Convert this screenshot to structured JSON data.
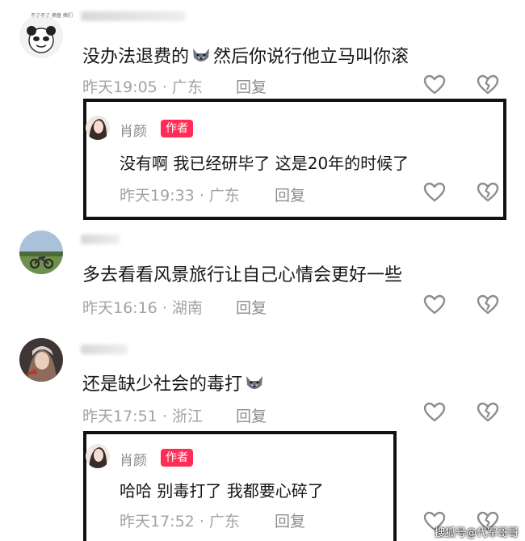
{
  "comments": [
    {
      "text": "没办法退费的",
      "text_after_emoji": "然后你说行他立马叫你滚",
      "time": "昨天19:05",
      "location": "广东",
      "reply": "回复",
      "avatar_caption_1": "不了不了",
      "avatar_caption_2": "摘盘 摘们",
      "reply_entry": {
        "author": "肖颜",
        "badge": "作者",
        "text": "没有啊 我已经研毕了 这是20年的时候了",
        "time": "昨天19:33",
        "location": "广东",
        "reply": "回复"
      }
    },
    {
      "text": "多去看看风景旅行让自己心情会更好一些",
      "time": "昨天16:16",
      "location": "湖南",
      "reply": "回复"
    },
    {
      "text": "还是缺少社会的毒打",
      "time": "昨天17:51",
      "location": "浙江",
      "reply": "回复",
      "reply_entry": {
        "author": "肖颜",
        "badge": "作者",
        "text": "哈哈 别毒打了 我都要心碎了",
        "time": "昨天17:52",
        "location": "广东",
        "reply": "回复"
      }
    }
  ],
  "separator": "·",
  "watermark": "搜狐号@代军哥哥",
  "icons": {
    "like": "heart-outline-icon",
    "dislike": "broken-heart-icon",
    "emoji": "husky-dog-emoji-icon"
  }
}
